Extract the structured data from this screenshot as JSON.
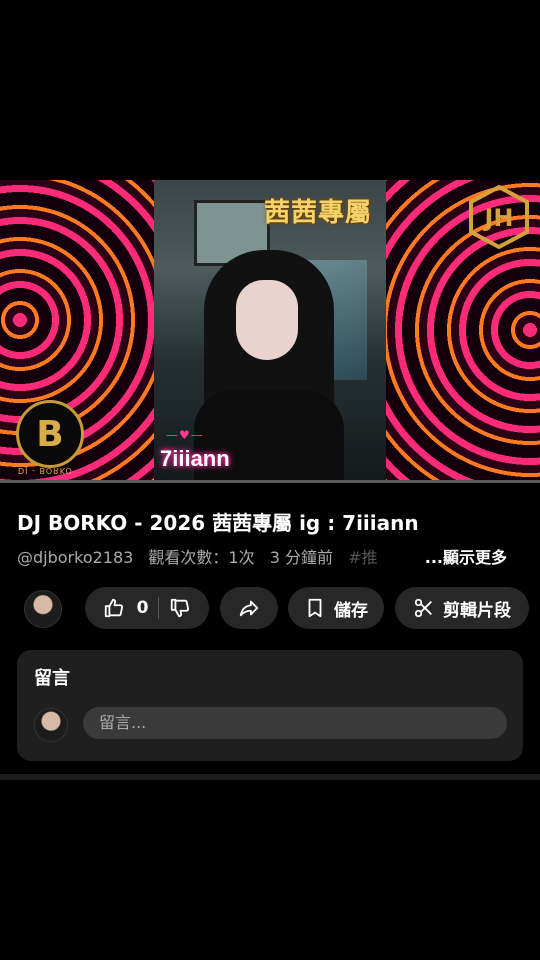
{
  "video": {
    "overlay_title": "茜茜專屬",
    "overlay_handle": "7iiiann",
    "heart_line": "—♥—",
    "logo_right_text": "JH",
    "logo_left_text": "B",
    "logo_left_caption": "DJ - BORKO",
    "progress": 0.0
  },
  "info": {
    "title": "DJ BORKO - 2026 茜茜專屬 ig : 7iiiann",
    "channel": "@djborko2183",
    "views": "觀看次數：1次",
    "time_ago": "3 分鐘前",
    "hashtag_partial": "#推",
    "show_more": "...顯示更多"
  },
  "actions": {
    "like_count": "0",
    "save_label": "儲存",
    "clip_label": "剪輯片段"
  },
  "comments": {
    "title": "留言",
    "placeholder": "留言..."
  }
}
